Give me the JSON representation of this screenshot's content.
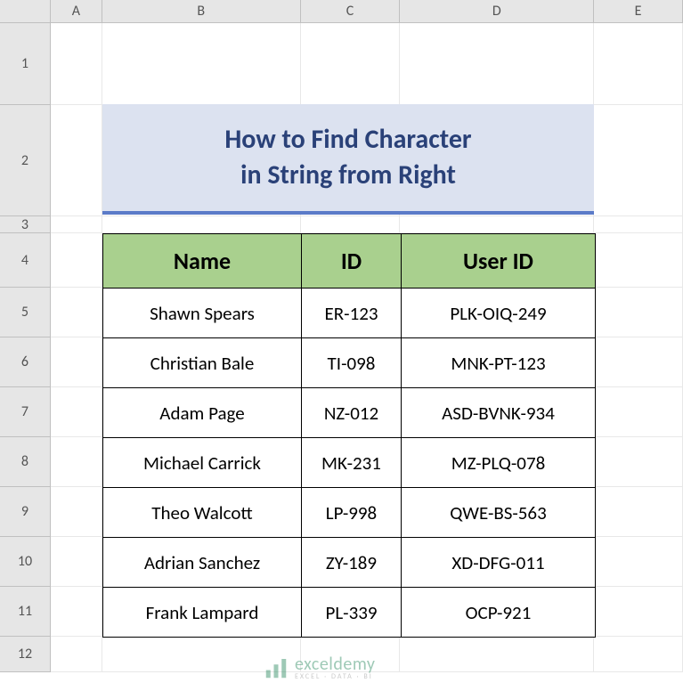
{
  "columns": [
    "A",
    "B",
    "C",
    "D",
    "E"
  ],
  "rows": [
    "1",
    "2",
    "3",
    "4",
    "5",
    "6",
    "7",
    "8",
    "9",
    "10",
    "11",
    "12"
  ],
  "title": {
    "line1": "How to Find Character",
    "line2": "in String from Right"
  },
  "headers": {
    "name": "Name",
    "id": "ID",
    "user_id": "User ID"
  },
  "data": [
    {
      "name": "Shawn Spears",
      "id": "ER-123",
      "user_id": "PLK-OIQ-249"
    },
    {
      "name": "Christian Bale",
      "id": "TI-098",
      "user_id": "MNK-PT-123"
    },
    {
      "name": "Adam Page",
      "id": "NZ-012",
      "user_id": "ASD-BVNK-934"
    },
    {
      "name": "Michael Carrick",
      "id": "MK-231",
      "user_id": "MZ-PLQ-078"
    },
    {
      "name": "Theo Walcott",
      "id": "LP-998",
      "user_id": "QWE-BS-563"
    },
    {
      "name": "Adrian Sanchez",
      "id": "ZY-189",
      "user_id": "XD-DFG-011"
    },
    {
      "name": "Frank Lampard",
      "id": "PL-339",
      "user_id": "OCP-921"
    }
  ],
  "watermark": {
    "main": "exceldemy",
    "sub": "EXCEL · DATA · BI"
  }
}
